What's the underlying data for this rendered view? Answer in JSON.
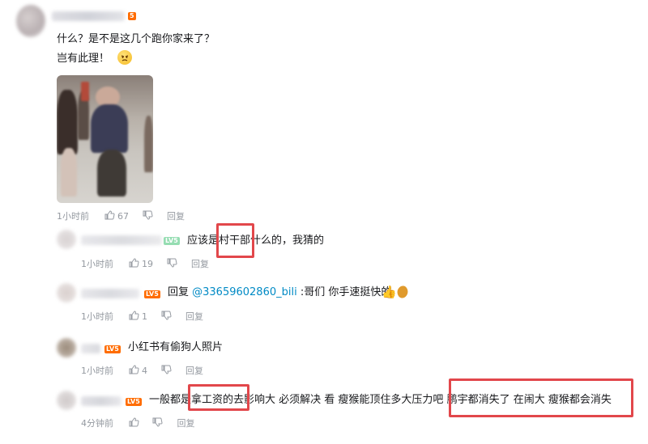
{
  "comments": {
    "top": {
      "level_badge": "5",
      "lines": [
        "什么？是不是这几个跑你家来了？",
        "岂有此理！"
      ],
      "emoji": "angry-face-emoji",
      "time": "1小时前",
      "likes": "67",
      "reply_label": "回复"
    },
    "replies": [
      {
        "level": "LV5",
        "level_color": "#95ddb2",
        "text_before": "应该是",
        "highlight": "村干部",
        "text_after": "什么的，我猜的",
        "time": "1小时前",
        "likes": "19",
        "reply_label": "回复"
      },
      {
        "level": "LV5",
        "level_color": "#ff6c00",
        "reply_prefix": "回复 ",
        "mention": "@33659602860_bili",
        "text": " :哥们 你手速挺快的",
        "emoji": "thumbs-up-and-chicken-leg-emoji",
        "time": "1小时前",
        "likes": "1",
        "reply_label": "回复"
      },
      {
        "level": "LV5",
        "level_color": "#ff6c00",
        "text": "小红书有偷狗人照片",
        "time": "1小时前",
        "likes": "4",
        "reply_label": "回复"
      },
      {
        "level": "LV5",
        "level_color": "#ff6c00",
        "text_before": "一般都是",
        "highlight1": "拿工资的去",
        "text_mid": "影响大 必须解决 看 瘦猴能顶住多大压力吧 ",
        "highlight2": "鹏宇都消失了 在闹大 瘦猴都会消失",
        "time": "4分钟前",
        "likes": "",
        "reply_label": "回复"
      }
    ]
  },
  "colors": {
    "highlight_box": "#e2474b",
    "meta_gray": "#9499a0",
    "mention_blue": "#008ac5"
  }
}
